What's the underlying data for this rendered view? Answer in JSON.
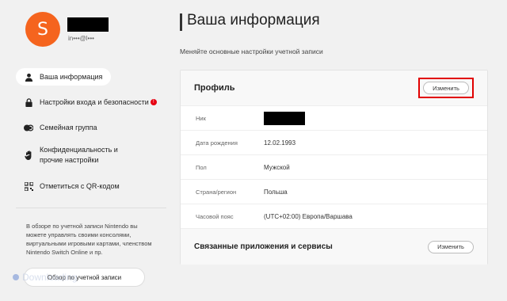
{
  "user": {
    "avatar_letter": "S",
    "email": "in•••@l•••"
  },
  "sidebar": {
    "items": [
      {
        "label": "Ваша информация",
        "icon": "person-icon",
        "active": true
      },
      {
        "label": "Настройки входа и безопасности",
        "icon": "lock-icon",
        "alert": "!"
      },
      {
        "label": "Семейная группа",
        "icon": "family-icon"
      },
      {
        "label": "Конфиденциальность и прочие настройки",
        "icon": "hand-icon"
      },
      {
        "label": "Отметиться с QR-кодом",
        "icon": "qr-icon"
      }
    ],
    "info_text": "В обзоре по учетной записи Nintendo вы можете управлять своими консолями, виртуальными игровыми картами, членством Nintendo Switch Online и пр.",
    "overview_button": "Обзор по учетной записи"
  },
  "watermark": "Downloading",
  "main": {
    "title": "Ваша информация",
    "subtitle": "Меняйте основные настройки учетной записи",
    "profile": {
      "title": "Профиль",
      "change_label": "Изменить",
      "rows": [
        {
          "label": "Ник",
          "value": ""
        },
        {
          "label": "Дата рождения",
          "value": "12.02.1993"
        },
        {
          "label": "Пол",
          "value": "Мужской"
        },
        {
          "label": "Страна/регион",
          "value": "Польша"
        },
        {
          "label": "Часовой пояс",
          "value": "(UTC+02:00) Европа/Варшава"
        }
      ]
    },
    "linked": {
      "title": "Связанные приложения и сервисы",
      "change_label": "Изменить"
    }
  },
  "colors": {
    "avatar": "#f5641e",
    "highlight": "#e10000",
    "alert": "#e60012"
  }
}
